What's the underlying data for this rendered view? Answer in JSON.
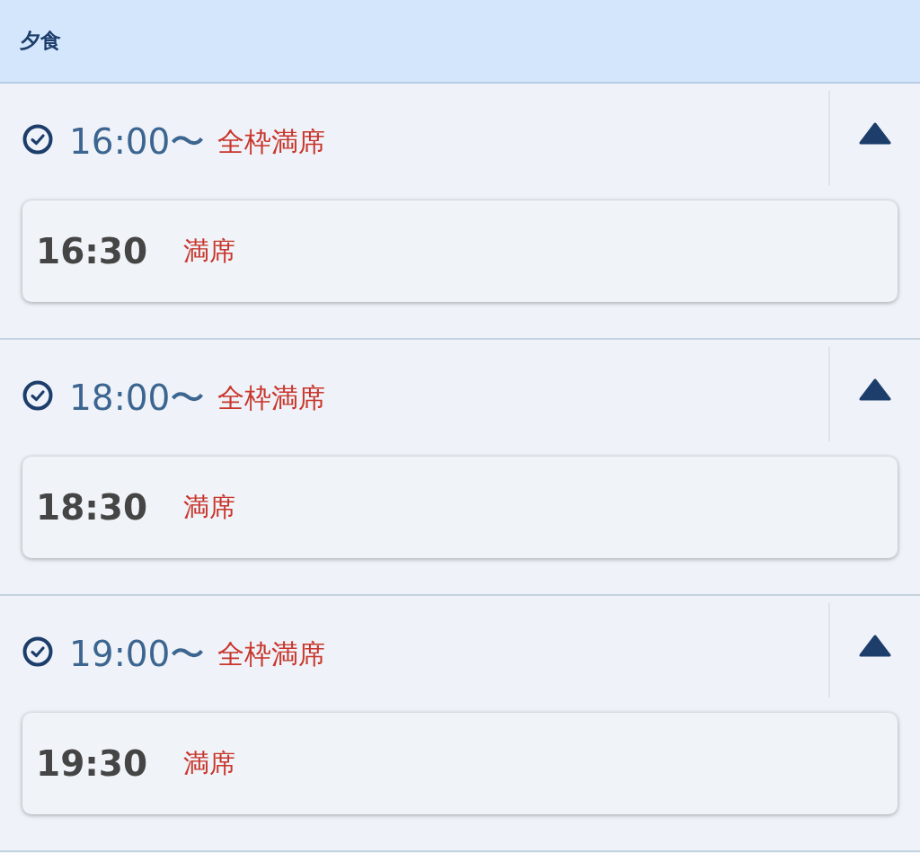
{
  "section": {
    "title": "夕食"
  },
  "groups": [
    {
      "time": "16:00〜",
      "status": "全枠満席",
      "expanded": true,
      "slots": [
        {
          "time": "16:30",
          "status": "満席"
        }
      ]
    },
    {
      "time": "18:00〜",
      "status": "全枠満席",
      "expanded": true,
      "slots": [
        {
          "time": "18:30",
          "status": "満席"
        }
      ]
    },
    {
      "time": "19:00〜",
      "status": "全枠満席",
      "expanded": true,
      "slots": [
        {
          "time": "19:30",
          "status": "満席"
        }
      ]
    }
  ]
}
